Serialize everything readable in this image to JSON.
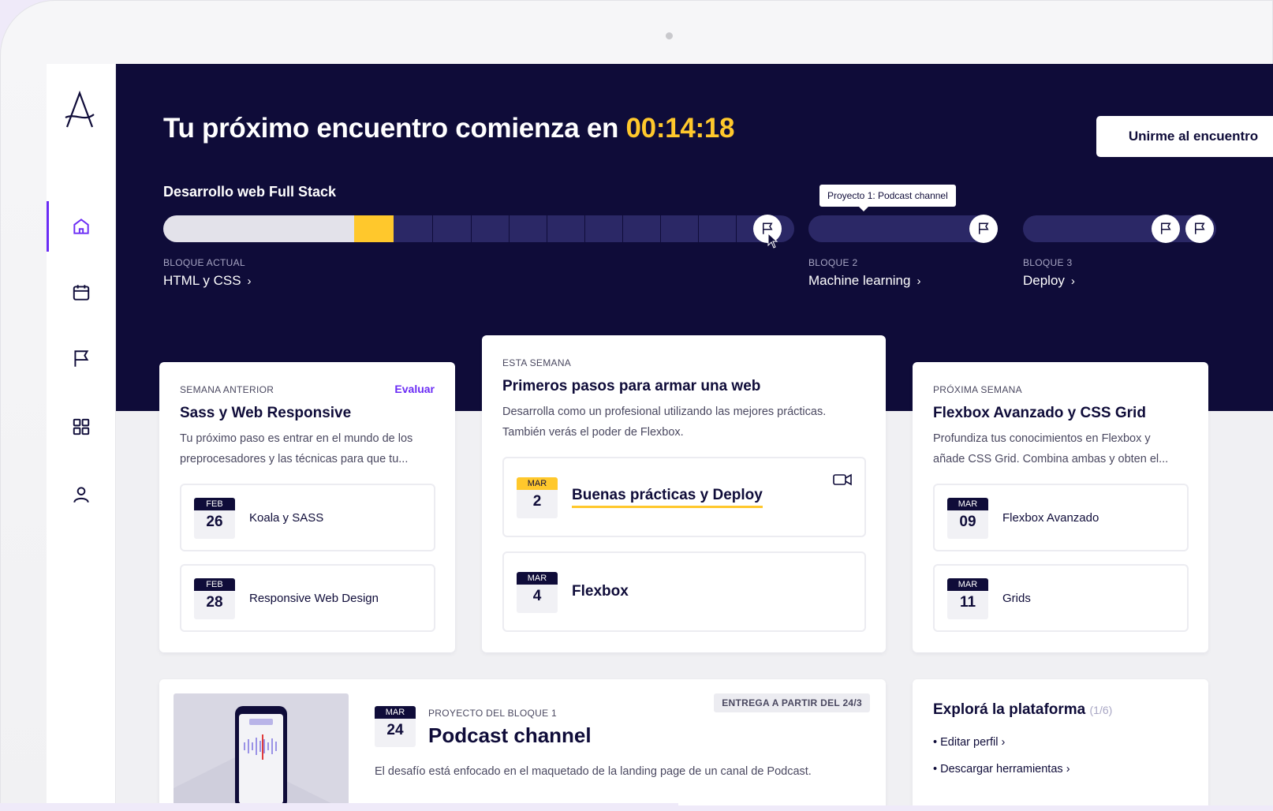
{
  "hero": {
    "title": "Tu próximo encuentro comienza en ",
    "timer": "00:14:18",
    "join_label": "Unirme al encuentro",
    "course_name": "Desarrollo web Full Stack",
    "tooltip": "Proyecto 1: Podcast channel",
    "current_progress": 0.3,
    "blocks": [
      {
        "caption": "BLOQUE ACTUAL",
        "name": "HTML y CSS"
      },
      {
        "caption": "BLOQUE 2",
        "name": "Machine learning"
      },
      {
        "caption": "BLOQUE 3",
        "name": "Deploy"
      }
    ]
  },
  "colors": {
    "navy": "#0f0c39",
    "accent": "#ffc82c",
    "purple": "#6b2cf5"
  },
  "sidebar": {
    "items": [
      "home-icon",
      "calendar-icon",
      "flag-icon",
      "grid-icon",
      "user-icon"
    ]
  },
  "cards": {
    "previous": {
      "eyebrow": "SEMANA ANTERIOR",
      "action": "Evaluar",
      "title": "Sass y Web Responsive",
      "desc_1": "Tu próximo paso es entrar en el mundo de los",
      "desc_2": "preprocesadores y las técnicas para que tu...",
      "sessions": [
        {
          "month": "FEB",
          "day": "26",
          "label": "Koala y SASS"
        },
        {
          "month": "FEB",
          "day": "28",
          "label": "Responsive Web Design"
        }
      ]
    },
    "current": {
      "eyebrow": "ESTA SEMANA",
      "title": "Primeros pasos para armar una web",
      "desc_1": "Desarrolla como un profesional utilizando las mejores prácticas.",
      "desc_2": "También verás el poder de Flexbox.",
      "sessions": [
        {
          "month": "MAR",
          "day": "2",
          "label": "Buenas prácticas y Deploy"
        },
        {
          "month": "MAR",
          "day": "4",
          "label": "Flexbox"
        }
      ]
    },
    "next": {
      "eyebrow": "PRÓXIMA SEMANA",
      "title": "Flexbox Avanzado y CSS Grid",
      "desc_1": "Profundiza tus conocimientos en Flexbox y",
      "desc_2": "añade CSS Grid. Combina ambas y obten el...",
      "sessions": [
        {
          "month": "MAR",
          "day": "09",
          "label": "Flexbox Avanzado"
        },
        {
          "month": "MAR",
          "day": "11",
          "label": "Grids"
        }
      ]
    }
  },
  "project": {
    "month": "MAR",
    "day": "24",
    "eyebrow": "PROYECTO DEL BLOQUE 1",
    "title": "Podcast channel",
    "badge": "ENTREGA A PARTIR DEL 24/3",
    "desc": "El desafío está enfocado en el maquetado de la landing page de un canal de Podcast."
  },
  "explore": {
    "title": "Explorá la plataforma",
    "count": "(1/6)",
    "items": [
      "Editar perfil",
      "Descargar herramientas"
    ]
  }
}
